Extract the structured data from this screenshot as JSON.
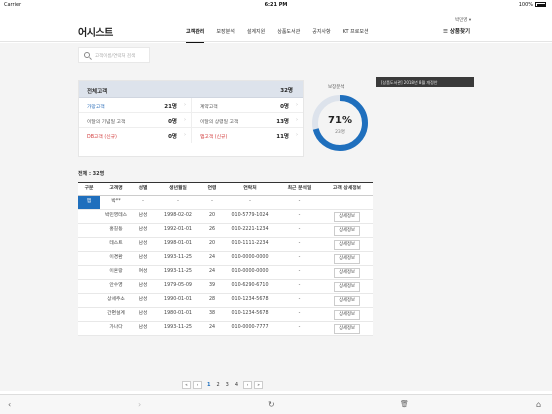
{
  "status": {
    "carrier": "Carrier",
    "time": "6:21 PM",
    "battery": "100%"
  },
  "header": {
    "logo": "어시스트",
    "user": "박민영 ▾",
    "nav": [
      "고객관리",
      "보장분석",
      "설계지원",
      "상품도서관",
      "공지사항",
      "KT 프로모션"
    ],
    "product_find": "☰ 상품찾기"
  },
  "search": {
    "placeholder": "고객이름/연락처 검색"
  },
  "notice": {
    "text": "[상품도서관] 2018년 8월 개정안"
  },
  "summary": {
    "total_label": "전체고객",
    "total_value": "32명",
    "rows": [
      [
        {
          "label": "가망고객",
          "value": "21명",
          "style": "blue"
        },
        {
          "label": "계약고객",
          "value": "0명",
          "style": ""
        }
      ],
      [
        {
          "label": "이달의 기념일 고객",
          "value": "0명",
          "style": ""
        },
        {
          "label": "이달의 상령일 고객",
          "value": "13명",
          "style": ""
        }
      ],
      [
        {
          "label": "DB고객 (신규)",
          "value": "0명",
          "style": "red"
        },
        {
          "label": "앱고객 (신규)",
          "value": "11명",
          "style": "red"
        }
      ]
    ],
    "chevron": "›"
  },
  "analysis": {
    "title": "보장분석",
    "percent": "71%",
    "count": "23명",
    "fraction": 0.71,
    "color": "#1f6fbd",
    "track": "#dde3ec"
  },
  "list": {
    "total": "전체 : 32명",
    "headers": [
      "구분",
      "고객명",
      "성별",
      "생년월일",
      "연령",
      "연락처",
      "최근 분석일",
      "고객 상세정보"
    ],
    "rows": [
      [
        "앱",
        "박**",
        "-",
        "-",
        "-",
        "-",
        "-",
        ""
      ],
      [
        "",
        "박민영테스",
        "남성",
        "1998-02-02",
        "20",
        "010-5779-1024",
        "-",
        "상세정보"
      ],
      [
        "",
        "홍길동",
        "남성",
        "1992-01-01",
        "26",
        "010-2221-1234",
        "-",
        "상세정보"
      ],
      [
        "",
        "테스트",
        "남성",
        "1998-01-01",
        "20",
        "010-1111-2234",
        "-",
        "상세정보"
      ],
      [
        "",
        "이경환",
        "남성",
        "1993-11-25",
        "24",
        "010-0000-0000",
        "-",
        "상세정보"
      ],
      [
        "",
        "이혼랑",
        "여성",
        "1993-11-25",
        "24",
        "010-0000-0000",
        "-",
        "상세정보"
      ],
      [
        "",
        "안수영",
        "남성",
        "1979-05-09",
        "39",
        "010-6290-6710",
        "-",
        "상세정보"
      ],
      [
        "",
        "상세주소",
        "남성",
        "1990-01-01",
        "28",
        "010-1234-5678",
        "-",
        "상세정보"
      ],
      [
        "",
        "간편설계",
        "남성",
        "1980-01-01",
        "38",
        "010-1234-5678",
        "-",
        "상세정보"
      ],
      [
        "",
        "가나다",
        "남성",
        "1993-11-25",
        "24",
        "010-0000-7777",
        "-",
        "상세정보"
      ]
    ]
  },
  "pager": {
    "first": "«",
    "prev": "‹",
    "pages": [
      "1",
      "2",
      "3",
      "4"
    ],
    "current": "1",
    "next": "›",
    "last": "»"
  },
  "toolbar": {
    "back": "‹",
    "forward": "›",
    "reload": "↻",
    "trash": "🗑",
    "home": "⌂"
  }
}
